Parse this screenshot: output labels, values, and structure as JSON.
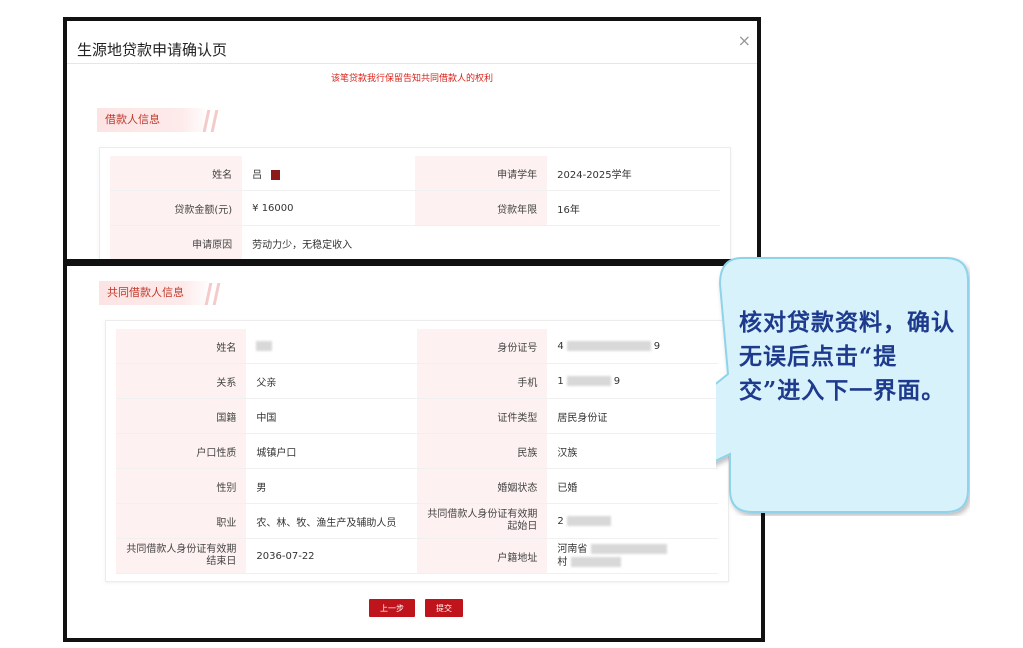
{
  "dialog": {
    "title": "生源地贷款申请确认页",
    "close_glyph": "×",
    "notice": "该笔贷款我行保留告知共同借款人的权利"
  },
  "borrower": {
    "section_title": "借款人信息",
    "name_label": "姓名",
    "name_value": "吕",
    "year_label": "申请学年",
    "year_value": "2024-2025学年",
    "amount_label": "贷款金额(元)",
    "amount_value": "¥ 16000",
    "term_label": "贷款年限",
    "term_value": "16年",
    "reason_label": "申请原因",
    "reason_value": "劳动力少，无稳定收入"
  },
  "coborrower": {
    "section_title": "共同借款人信息",
    "name_label": "姓名",
    "id_label": "身份证号",
    "id_value_start": "4",
    "id_value_end": "9",
    "relation_label": "关系",
    "relation_value": "父亲",
    "phone_label": "手机",
    "phone_value_start": "1",
    "phone_value_end": "9",
    "nationality_label": "国籍",
    "nationality_value": "中国",
    "idtype_label": "证件类型",
    "idtype_value": "居民身份证",
    "hukou_label": "户口性质",
    "hukou_value": "城镇户口",
    "ethnic_label": "民族",
    "ethnic_value": "汉族",
    "gender_label": "性别",
    "gender_value": "男",
    "marital_label": "婚姻状态",
    "marital_value": "已婚",
    "job_label": "职业",
    "job_value": "农、林、牧、渔生产及辅助人员",
    "valid_start_label": "共同借款人身份证有效期起始日",
    "valid_start_value": "2",
    "valid_end_label": "共同借款人身份证有效期结束日",
    "valid_end_value": "2036-07-22",
    "address_label": "户籍地址",
    "address_value_1": "河南省",
    "address_value_2": "村"
  },
  "actions": {
    "prev_label": "上一步",
    "submit_label": "提交"
  },
  "callout": {
    "text": "核对贷款资料，确认无误后点击“提交”进入下一界面。",
    "fill_color": "#d8f2fb",
    "stroke_color": "#8fd3ea",
    "text_color": "#1e3a8c"
  }
}
